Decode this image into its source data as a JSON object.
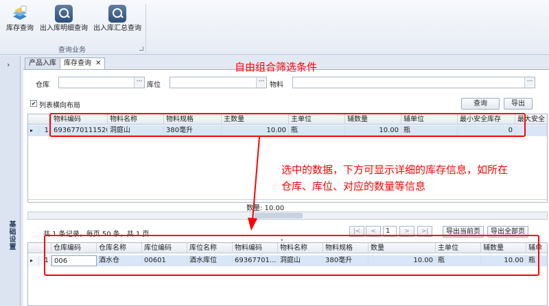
{
  "ribbon": {
    "buttons": [
      {
        "label": "库存查询",
        "icon": "stock-query-icon"
      },
      {
        "label": "出入库明细查询",
        "icon": "search-icon"
      },
      {
        "label": "出入库汇总查询",
        "icon": "search-icon"
      }
    ],
    "group_label": "查询业务"
  },
  "leftnav": {
    "toggle": "›",
    "section": "基础设置"
  },
  "tabs": [
    {
      "label": "产品入库",
      "active": false
    },
    {
      "label": "库存查询",
      "active": true,
      "close": "✕"
    }
  ],
  "filter": {
    "warehouse_label": "仓库",
    "location_label": "库位",
    "material_label": "物料",
    "warehouse_value": "",
    "location_value": "",
    "material_value": "",
    "ellipsis": "···",
    "horizontal_layout_label": "列表横向布局",
    "horizontal_layout_checked": true,
    "query_button": "查询",
    "export_button": "导出"
  },
  "top_grid": {
    "columns": [
      "物料编码",
      "物料名称",
      "物料规格",
      "主数量",
      "主单位",
      "辅数量",
      "辅单位",
      "最小安全库存",
      "最大安全"
    ],
    "rows": [
      {
        "indicator": "▸",
        "no": "1",
        "cells": [
          "6936770111520",
          "洞庭山",
          "380毫升",
          "10.00",
          "瓶",
          "10.00",
          "瓶",
          "0",
          ""
        ]
      }
    ],
    "summary": "数量: 10.00"
  },
  "pager": {
    "info": "共 1 条记录，每页 50 条，共 1 页",
    "first": "|<",
    "prev": "<",
    "page": "1",
    "next": ">",
    "last": ">|",
    "export_current": "导出当前页",
    "export_all": "导出全部页"
  },
  "bottom_grid": {
    "columns": [
      "仓库编码",
      "仓库名称",
      "库位编码",
      "库位名称",
      "物料编码",
      "物料名称",
      "物料规格",
      "数量",
      "主单位",
      "辅数量",
      "辅单"
    ],
    "rows": [
      {
        "indicator": "▸",
        "no": "1",
        "cells": [
          "006",
          "酒水仓",
          "00601",
          "酒水库位",
          "69367701...",
          "洞庭山",
          "380毫升",
          "10.00",
          "瓶",
          "10.00",
          "瓶"
        ]
      }
    ]
  },
  "annotations": {
    "title": "自由组合筛选条件",
    "note_line1": "选中的数据，下方可显示详细的库存信息，如所在",
    "note_line2": "仓库、库位、对应的数量等信息",
    "color": "#ff0000"
  }
}
